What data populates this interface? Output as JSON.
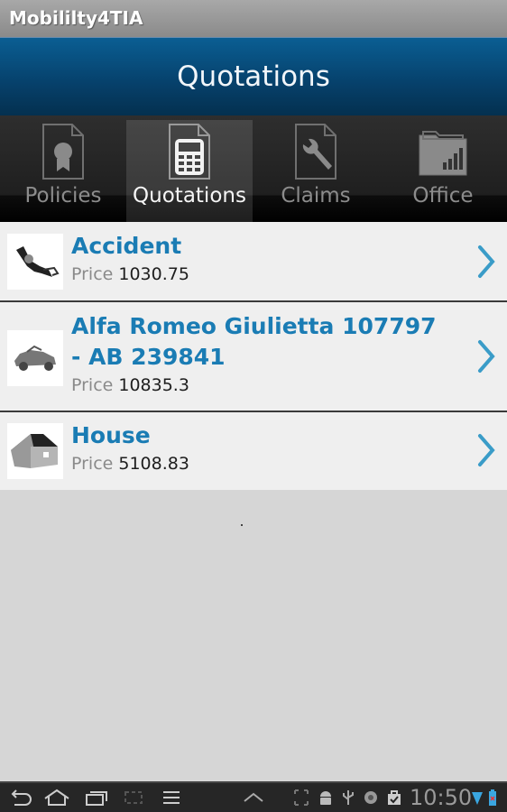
{
  "app": {
    "title": "Mobililty4TIA"
  },
  "header": {
    "title": "Quotations"
  },
  "tabs": [
    {
      "label": "Policies",
      "icon": "certificate-document-icon",
      "active": false
    },
    {
      "label": "Quotations",
      "icon": "calculator-document-icon",
      "active": true
    },
    {
      "label": "Claims",
      "icon": "wrench-document-icon",
      "active": false
    },
    {
      "label": "Office",
      "icon": "chart-folder-icon",
      "active": false
    }
  ],
  "quotations": [
    {
      "title": "Accident",
      "price_label": "Price",
      "price": "1030.75",
      "icon": "accident-leg-icon"
    },
    {
      "title": "Alfa Romeo Giulietta 107797 - AB 239841",
      "price_label": "Price",
      "price": "10835.3",
      "icon": "car-icon"
    },
    {
      "title": "House",
      "price_label": "Price",
      "price": "5108.83",
      "icon": "house-icon"
    }
  ],
  "system_bar": {
    "time": "10:50",
    "nav_buttons": [
      "back",
      "home",
      "recent-apps",
      "screenshot",
      "menu"
    ],
    "status_icons": [
      "expand",
      "android-debug",
      "usb",
      "sync",
      "store-check",
      "wifi",
      "battery"
    ]
  },
  "colors": {
    "accent": "#1a7cb4",
    "header": "#06406a"
  }
}
